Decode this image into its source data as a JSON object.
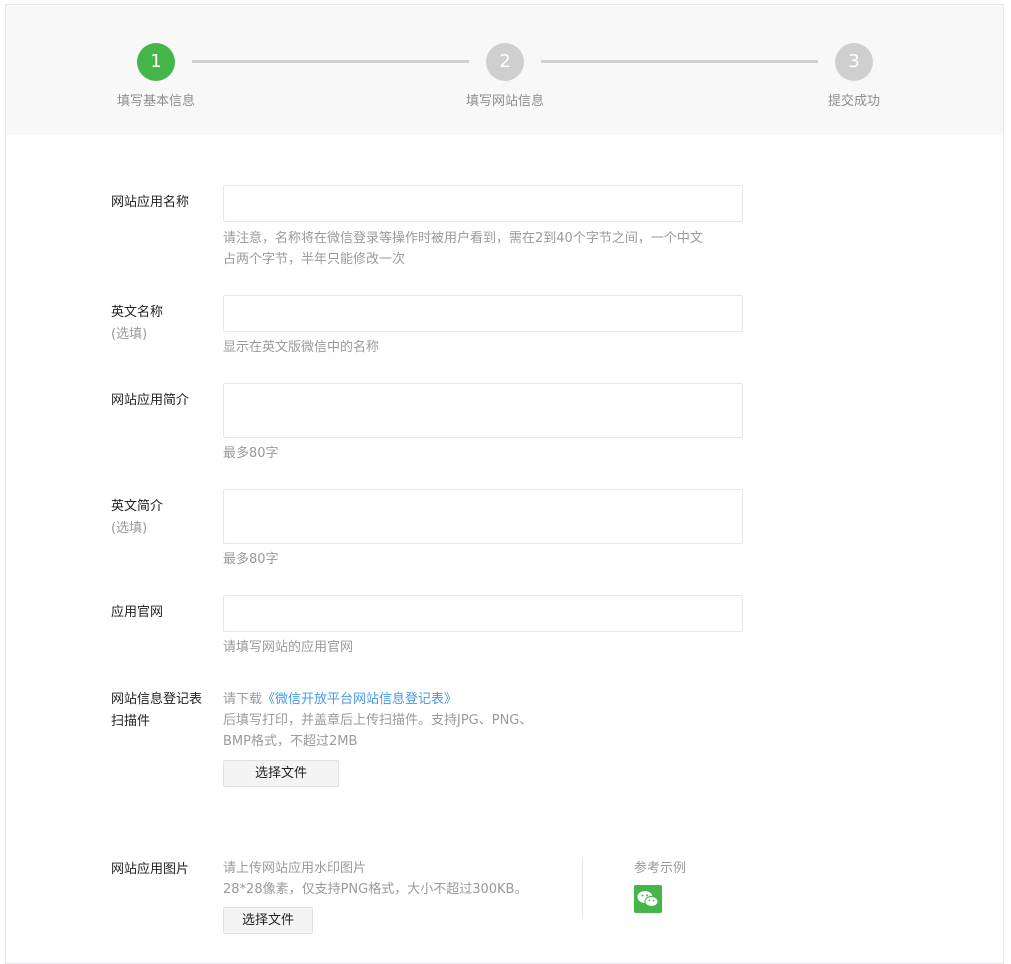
{
  "steps": [
    {
      "num": "1",
      "label": "填写基本信息"
    },
    {
      "num": "2",
      "label": "填写网站信息"
    },
    {
      "num": "3",
      "label": "提交成功"
    }
  ],
  "form": {
    "name": {
      "label": "网站应用名称",
      "tip_line1": "请注意，名称将在微信登录等操作时被用户看到，需在2到40个字节之间，一个中文",
      "tip_line2": "占两个字节，半年只能修改一次"
    },
    "en_name": {
      "label": "英文名称",
      "optional": "(选填)",
      "tip": "显示在英文版微信中的名称"
    },
    "intro": {
      "label": "网站应用简介",
      "tip": "最多80字"
    },
    "en_intro": {
      "label": "英文简介",
      "optional": "(选填)",
      "tip": "最多80字"
    },
    "website": {
      "label": "应用官网",
      "placeholder": "请填写网站的应用官网"
    },
    "register_form": {
      "label_line1": "网站信息登记表",
      "label_line2": "扫描件",
      "tip_prefix": "请下载",
      "tip_link": "《微信开放平台网站信息登记表》",
      "tip_line2": "后填写打印，并盖章后上传扫描件。支持JPG、PNG、",
      "tip_line3": "BMP格式，不超过2MB",
      "button": "选择文件"
    },
    "app_image": {
      "label": "网站应用图片",
      "tip_line1": "请上传网站应用水印图片",
      "tip_line2": "28*28像素，仅支持PNG格式，大小不超过300KB。",
      "button": "选择文件",
      "example_label": "参考示例"
    }
  },
  "colors": {
    "accent": "#44b549",
    "link": "#459ae9"
  }
}
